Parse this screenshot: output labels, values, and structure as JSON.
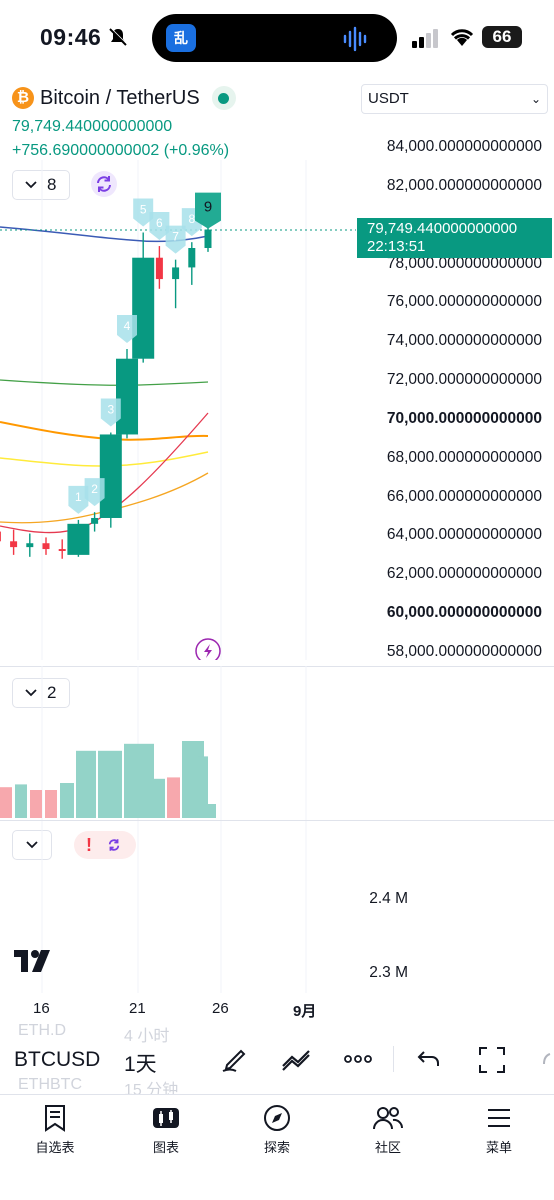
{
  "status_bar": {
    "time": "09:46",
    "island_app": "乱",
    "battery": "66"
  },
  "header": {
    "symbol_name": "Bitcoin / TetherUS",
    "last_price": "79,749.440000000000",
    "change": "+756.690000000002 (+0.96%)",
    "currency": "USDT"
  },
  "indicators": {
    "main_count": "8",
    "volume_count": "2"
  },
  "price_axis": {
    "labels": [
      "84,000.000000000000",
      "82,000.000000000000",
      "78,000.000000000000",
      "76,000.000000000000",
      "74,000.000000000000",
      "72,000.000000000000",
      "70,000.000000000000",
      "68,000.000000000000",
      "66,000.000000000000",
      "64,000.000000000000",
      "62,000.000000000000",
      "60,000.000000000000",
      "58,000.000000000000"
    ],
    "current_price": "79,749.440000000000",
    "countdown": "22:13:51"
  },
  "volume_axis": {
    "labels": [
      "2.4 M",
      "2.3 M"
    ]
  },
  "time_axis": {
    "labels": [
      "16",
      "21",
      "26",
      "9月"
    ]
  },
  "td_markers": [
    "1",
    "2",
    "3",
    "4",
    "5",
    "6",
    "7",
    "8",
    "9"
  ],
  "toolbar": {
    "symbol": "BTCUSD",
    "interval": "1天",
    "ghost_symbol_1": "ETH.D",
    "ghost_interval_1": "4 小时",
    "ghost_symbol_2": "ETHBTC",
    "ghost_interval_2": "15 分钟"
  },
  "bottom_nav": [
    {
      "label": "自选表",
      "icon": "watchlist-icon"
    },
    {
      "label": "图表",
      "icon": "chart-icon"
    },
    {
      "label": "探索",
      "icon": "compass-icon"
    },
    {
      "label": "社区",
      "icon": "community-icon"
    },
    {
      "label": "菜单",
      "icon": "menu-icon"
    }
  ],
  "colors": {
    "up": "#089981",
    "down": "#f23645",
    "td_marker": "#a7e0ea",
    "accent": "#2962ff",
    "purple": "#7b3fe4"
  },
  "chart_data": [
    {
      "type": "candlestick",
      "x": [
        "~Aug 8",
        "~Aug 9",
        "~Aug 10",
        "~Aug 11",
        "~Aug 12",
        "~Aug 13",
        "~Aug 14",
        "~Aug 15",
        "~Aug 16",
        "~Aug 17",
        "~Aug 18",
        "~Aug 19",
        "~Aug 20",
        "~Aug 21",
        "~Aug 22",
        "~Aug 23",
        "~Aug 24",
        "~Aug 25"
      ],
      "ohlc": [
        [
          64200,
          64800,
          63100,
          63700
        ],
        [
          63700,
          64300,
          63000,
          63400
        ],
        [
          63400,
          64100,
          62900,
          63600
        ],
        [
          63600,
          63900,
          63000,
          63300
        ],
        [
          63300,
          63800,
          62800,
          63200
        ],
        [
          63000,
          64800,
          62900,
          64600
        ],
        [
          64600,
          65200,
          64200,
          64900
        ],
        [
          64900,
          69300,
          64400,
          69200
        ],
        [
          69200,
          73600,
          69000,
          73100
        ],
        [
          73100,
          79600,
          72900,
          78300
        ],
        [
          78300,
          78900,
          76700,
          77200
        ],
        [
          77200,
          78200,
          75700,
          77800
        ],
        [
          77800,
          79100,
          76900,
          78800
        ],
        [
          78800,
          79900,
          78600,
          79749.44
        ]
      ],
      "ylim": [
        57700,
        84700
      ],
      "td_sequence": [
        1,
        2,
        3,
        4,
        5,
        6,
        7,
        8,
        9
      ]
    },
    {
      "type": "bar",
      "title": "Volume",
      "values": [
        1.72,
        1.74,
        1.7,
        1.7,
        1.75,
        1.98,
        1.98,
        2.03,
        1.78,
        1.79,
        2.05,
        1.94,
        1.6
      ],
      "ylim": [
        1.5,
        2.5
      ]
    }
  ]
}
